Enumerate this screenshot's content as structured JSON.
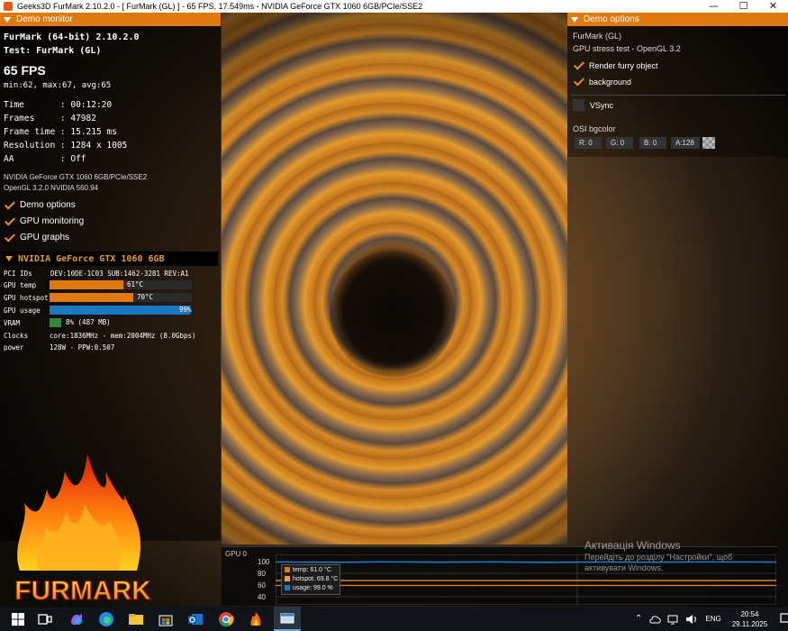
{
  "window": {
    "title": "Geeks3D FurMark 2.10.2.0 - [ FurMark (GL) ] - 65 FPS, 17.549ms - NVIDIA GeForce GTX 1060 6GB/PCIe/SSE2",
    "minimize": "—",
    "maximize": "☐",
    "close": "✕"
  },
  "demo_monitor": {
    "header": "Demo monitor",
    "app_line": "FurMark (64-bit) 2.10.2.0",
    "test_line": "Test: FurMark (GL)",
    "fps": "65 FPS",
    "fps_stats": "min:62, max:67, avg:65",
    "time": "Time       : 00:12:20",
    "frames": "Frames     : 47982",
    "frame_time": "Frame time : 15.215 ms",
    "resolution": "Resolution : 1284 x 1005",
    "aa": "AA         : Off",
    "gpu_name": "NVIDIA GeForce GTX 1060 6GB/PCIe/SSE2",
    "opengl": "OpenGL 3.2.0 NVIDIA 560.94",
    "checks": [
      "Demo options",
      "GPU monitoring",
      "GPU graphs"
    ]
  },
  "gpu_panel": {
    "header": "NVIDIA GeForce GTX 1060 6GB",
    "pci_label": "PCI IDs",
    "pci_value": "DEV:10DE-1C03 SUB:1462-3281 REV:A1",
    "temp_label": "GPU temp",
    "temp_value": "61°C",
    "temp_pct": 0.52,
    "hotspot_label": "GPU hotspot",
    "hotspot_value": "70°C",
    "hotspot_pct": 0.59,
    "usage_label": "GPU usage",
    "usage_value": "99%",
    "usage_pct": 0.99,
    "vram_label": "VRAM",
    "vram_value": "8% (487 MB)",
    "vram_pct": 0.08,
    "clocks_label": "Clocks",
    "clocks_value": "core:1836MHz - mem:2004MHz (8.0Gbps)",
    "power_label": "power",
    "power_value": "128W - PPW:0.507",
    "colors": {
      "temp": "#e07a10",
      "hotspot": "#e07a10",
      "usage": "#1a78c2",
      "vram": "#2e8b3a"
    }
  },
  "logo": {
    "text": "FURMARK"
  },
  "demo_options": {
    "header": "Demo options",
    "app": "FurMark (GL)",
    "subtitle": "GPU stress test - OpenGL 3.2",
    "render_furry": "Render furry object",
    "background": "background",
    "vsync": "VSync",
    "osi_bgcolor": "OSI bgcolor",
    "r": "R: 0",
    "g": "G: 0",
    "b": "B: 0",
    "a": "A:128"
  },
  "graph": {
    "label": "GPU 0",
    "ticks": [
      "100",
      "80",
      "60",
      "40"
    ],
    "legend": [
      {
        "text": "temp: 61.0 °C",
        "color": "#e07a10"
      },
      {
        "text": "hotspot: 69.8 °C",
        "color": "#f0a040"
      },
      {
        "text": "usage: 99.0 %",
        "color": "#1a78c2"
      }
    ]
  },
  "activation": {
    "title": "Активація Windows",
    "line1": "Перейдіть до розділу \"Настройки\", щоб",
    "line2": "активувати Windows."
  },
  "taskbar": {
    "lang": "ENG",
    "time": "20:54",
    "date": "29.11.2025",
    "notifications": "2",
    "icons": [
      "windows-start-icon",
      "task-view-icon",
      "copilot-icon",
      "edge-icon",
      "file-explorer-icon",
      "store-icon",
      "outlook-icon",
      "chrome-icon",
      "furmark-taskbar-icon",
      "furmark-window-icon"
    ]
  }
}
